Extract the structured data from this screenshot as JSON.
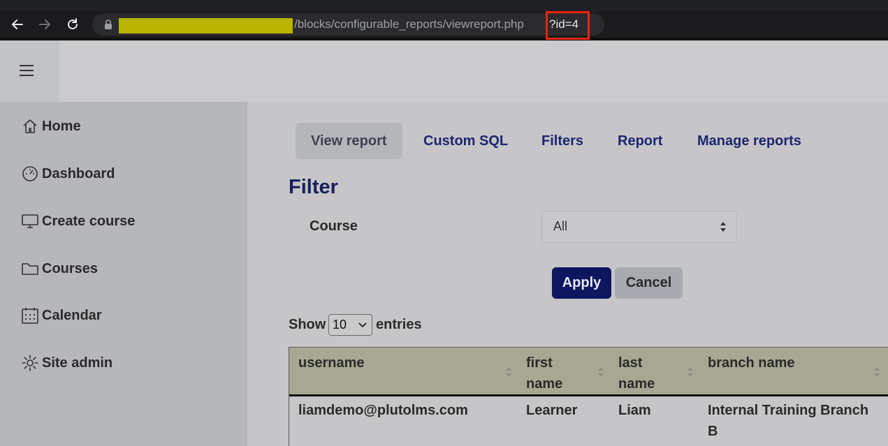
{
  "browser": {
    "url_path": "/blocks/configurable_reports/viewreport.php",
    "url_query": "?id=4"
  },
  "sidebar": {
    "items": [
      {
        "label": "Home",
        "icon": "home-icon"
      },
      {
        "label": "Dashboard",
        "icon": "dashboard-icon"
      },
      {
        "label": "Create course",
        "icon": "monitor-icon"
      },
      {
        "label": "Courses",
        "icon": "folder-icon"
      },
      {
        "label": "Calendar",
        "icon": "calendar-icon"
      },
      {
        "label": "Site admin",
        "icon": "gear-icon"
      }
    ]
  },
  "tabs": [
    {
      "label": "View report",
      "active": true
    },
    {
      "label": "Custom SQL",
      "active": false
    },
    {
      "label": "Filters",
      "active": false
    },
    {
      "label": "Report",
      "active": false
    },
    {
      "label": "Manage reports",
      "active": false
    }
  ],
  "filter": {
    "title": "Filter",
    "course_label": "Course",
    "course_value": "All",
    "apply_label": "Apply",
    "cancel_label": "Cancel"
  },
  "entries": {
    "show_label": "Show",
    "value": "10",
    "entries_label": "entries"
  },
  "table": {
    "columns": [
      "username",
      "first name",
      "last name",
      "branch name"
    ],
    "rows": [
      [
        "liamdemo@plutolms.com",
        "Learner",
        "Liam",
        "Internal Training Branch B"
      ]
    ]
  },
  "colors": {
    "accent": "#0f1660",
    "highlight": "#e8250c",
    "redaction": "#b9b400",
    "table_header": "#a7a793"
  }
}
